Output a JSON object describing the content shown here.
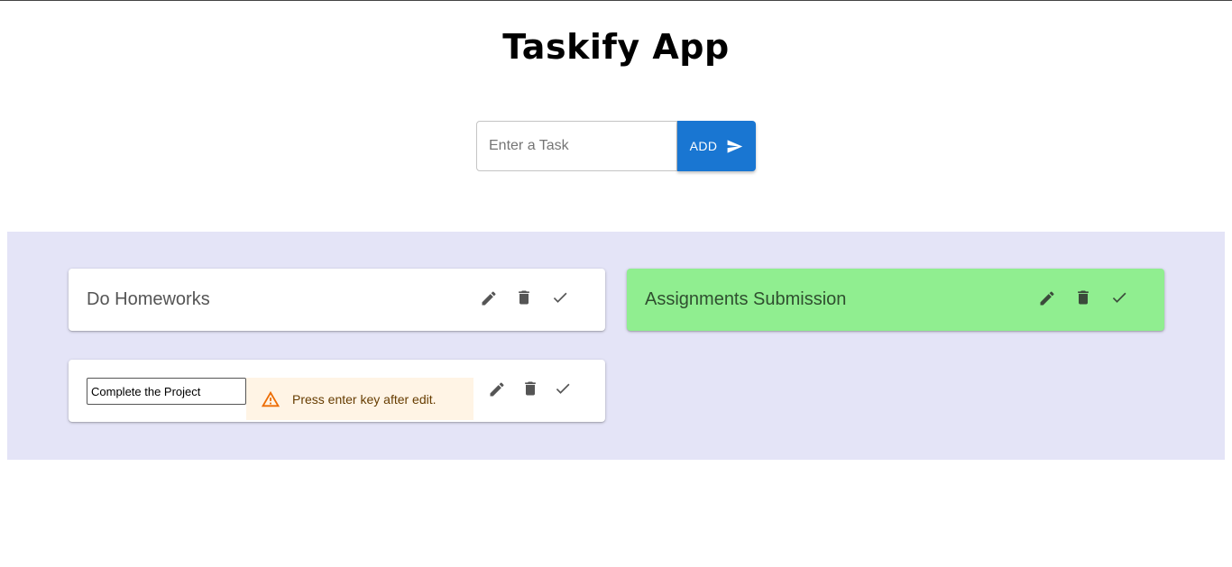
{
  "app": {
    "title": "Taskify App"
  },
  "new_task": {
    "placeholder": "Enter a Task",
    "add_label": "ADD"
  },
  "tasks": [
    {
      "text": "Do Homeworks",
      "status": "active"
    },
    {
      "text": "Assignments Submission",
      "status": "done"
    },
    {
      "text": "Complete the Project",
      "status": "editing"
    }
  ],
  "edit_alert": {
    "message": "Press enter key after edit.",
    "severity": "warning"
  },
  "icons": {
    "add": "send-icon",
    "edit": "pencil-icon",
    "delete": "trash-icon",
    "done": "check-icon",
    "alert": "warning-triangle-icon"
  },
  "colors": {
    "accent": "#1976d2",
    "board_bg": "#e4e4f7",
    "done_bg": "#90ee90",
    "alert_bg": "#fff4e5",
    "alert_icon": "#ed6c02"
  }
}
